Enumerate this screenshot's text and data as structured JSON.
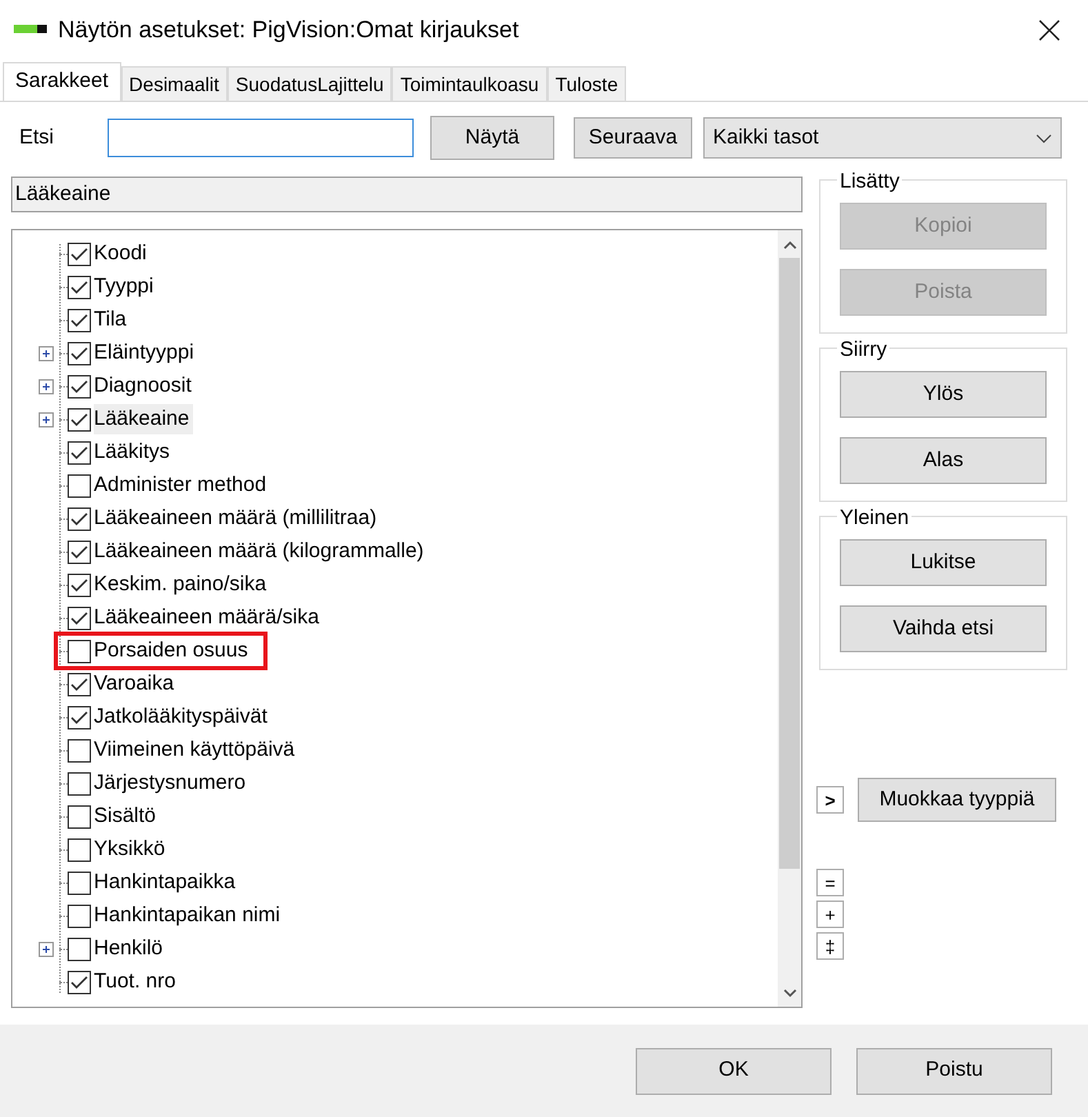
{
  "window": {
    "title": "Näytön asetukset: PigVision:Omat kirjaukset"
  },
  "tabs": [
    {
      "label": "Sarakkeet",
      "selected": true
    },
    {
      "label": "Desimaalit",
      "selected": false
    },
    {
      "label": "SuodatusLajittelu",
      "selected": false
    },
    {
      "label": "Toimintaulkoasu",
      "selected": false
    },
    {
      "label": "Tuloste",
      "selected": false
    }
  ],
  "search": {
    "label": "Etsi",
    "buttons": [
      "Näytä",
      "Seuraava"
    ],
    "level_select": "Kaikki tasot"
  },
  "path_field": "Lääkeaine",
  "tree": [
    {
      "label": "Koodi",
      "checked": true,
      "expandable": false,
      "selected": false,
      "highlighted": false
    },
    {
      "label": "Tyyppi",
      "checked": true,
      "expandable": false,
      "selected": false,
      "highlighted": false
    },
    {
      "label": "Tila",
      "checked": true,
      "expandable": false,
      "selected": false,
      "highlighted": false
    },
    {
      "label": "Eläintyyppi",
      "checked": true,
      "expandable": true,
      "selected": false,
      "highlighted": false
    },
    {
      "label": "Diagnoosit",
      "checked": true,
      "expandable": true,
      "selected": false,
      "highlighted": false
    },
    {
      "label": "Lääkeaine",
      "checked": true,
      "expandable": true,
      "selected": true,
      "highlighted": false
    },
    {
      "label": "Lääkitys",
      "checked": true,
      "expandable": false,
      "selected": false,
      "highlighted": false
    },
    {
      "label": "Administer method",
      "checked": false,
      "expandable": false,
      "selected": false,
      "highlighted": false
    },
    {
      "label": "Lääkeaineen määrä (millilitraa)",
      "checked": true,
      "expandable": false,
      "selected": false,
      "highlighted": false
    },
    {
      "label": "Lääkeaineen määrä (kilogrammalle)",
      "checked": true,
      "expandable": false,
      "selected": false,
      "highlighted": false
    },
    {
      "label": "Keskim. paino/sika",
      "checked": true,
      "expandable": false,
      "selected": false,
      "highlighted": false
    },
    {
      "label": "Lääkeaineen määrä/sika",
      "checked": true,
      "expandable": false,
      "selected": false,
      "highlighted": false
    },
    {
      "label": "Porsaiden osuus",
      "checked": false,
      "expandable": false,
      "selected": false,
      "highlighted": true
    },
    {
      "label": "Varoaika",
      "checked": true,
      "expandable": false,
      "selected": false,
      "highlighted": false
    },
    {
      "label": "Jatkolääkityspäivät",
      "checked": true,
      "expandable": false,
      "selected": false,
      "highlighted": false
    },
    {
      "label": "Viimeinen käyttöpäivä",
      "checked": false,
      "expandable": false,
      "selected": false,
      "highlighted": false
    },
    {
      "label": "Järjestysnumero",
      "checked": false,
      "expandable": false,
      "selected": false,
      "highlighted": false
    },
    {
      "label": "Sisältö",
      "checked": false,
      "expandable": false,
      "selected": false,
      "highlighted": false
    },
    {
      "label": "Yksikkö",
      "checked": false,
      "expandable": false,
      "selected": false,
      "highlighted": false
    },
    {
      "label": "Hankintapaikka",
      "checked": false,
      "expandable": false,
      "selected": false,
      "highlighted": false
    },
    {
      "label": "Hankintapaikan nimi",
      "checked": false,
      "expandable": false,
      "selected": false,
      "highlighted": false
    },
    {
      "label": "Henkilö",
      "checked": false,
      "expandable": true,
      "selected": false,
      "highlighted": false
    },
    {
      "label": "Tuot. nro",
      "checked": true,
      "expandable": false,
      "selected": false,
      "highlighted": false
    }
  ],
  "groups": [
    {
      "title": "Lisätty",
      "buttons": [
        {
          "label": "Kopioi",
          "disabled": true
        },
        {
          "label": "Poista",
          "disabled": true
        }
      ]
    },
    {
      "title": "Siirry",
      "buttons": [
        {
          "label": "Ylös",
          "disabled": false
        },
        {
          "label": "Alas",
          "disabled": false
        }
      ]
    },
    {
      "title": "Yleinen",
      "buttons": [
        {
          "label": "Lukitse",
          "disabled": false
        },
        {
          "label": "Vaihda etsi",
          "disabled": false
        }
      ]
    }
  ],
  "expand_button": ">",
  "edit_type_button": "Muokkaa tyyppiä",
  "small_buttons": [
    "=",
    "+",
    "‡"
  ],
  "footer_buttons": [
    "OK",
    "Poistu"
  ]
}
